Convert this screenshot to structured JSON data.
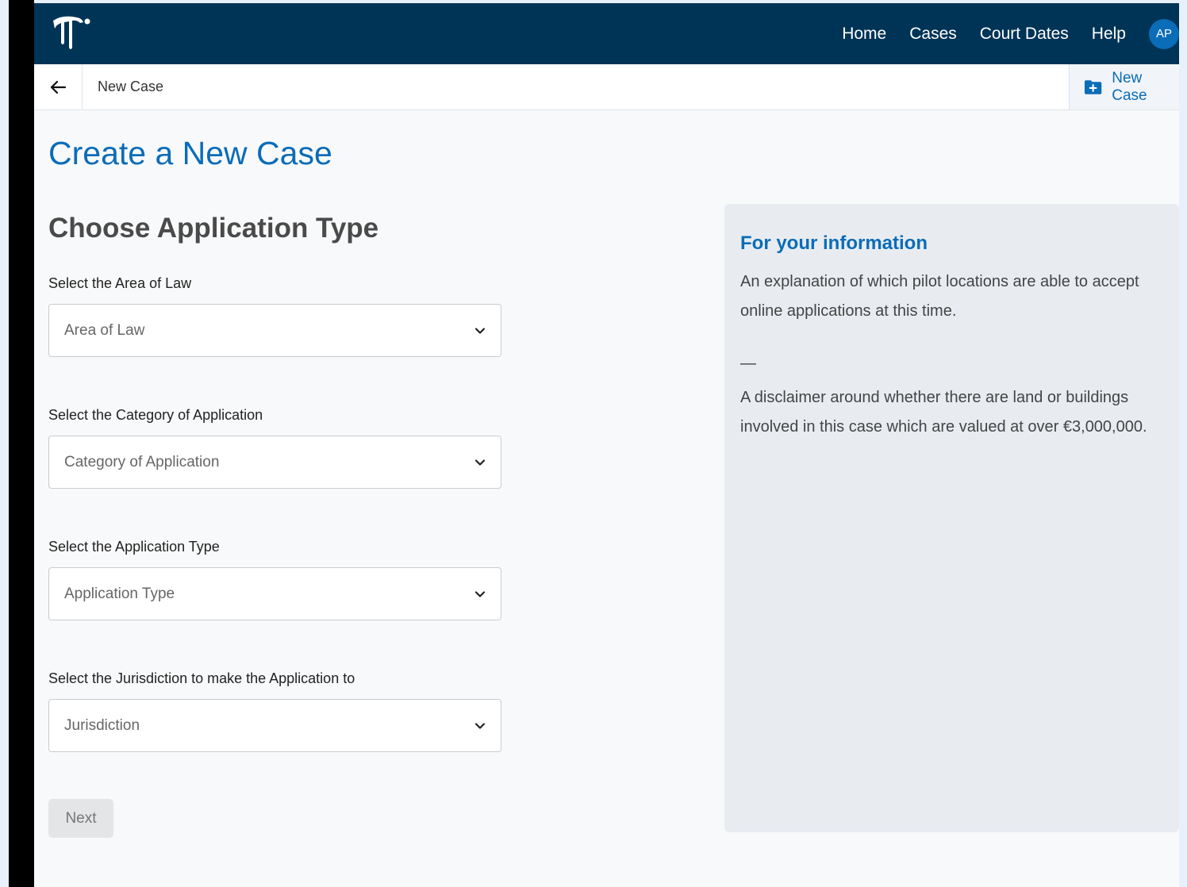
{
  "nav": {
    "links": [
      "Home",
      "Cases",
      "Court Dates",
      "Help"
    ],
    "avatar_initials": "AP"
  },
  "subbar": {
    "title": "New Case",
    "action_label": "New Case"
  },
  "page": {
    "title": "Create a New Case",
    "section_title": "Choose Application Type"
  },
  "form": {
    "fields": [
      {
        "label": "Select the Area of Law",
        "placeholder": "Area of Law"
      },
      {
        "label": "Select the Category of Application",
        "placeholder": "Category of Application"
      },
      {
        "label": "Select the Application Type",
        "placeholder": "Application Type"
      },
      {
        "label": "Select the Jurisdiction to make the Application to",
        "placeholder": "Jurisdiction"
      }
    ],
    "next_label": "Next"
  },
  "info": {
    "title": "For your information",
    "paragraph1": "An explanation of which pilot locations are able to accept online applications at this time.",
    "separator": "—",
    "paragraph2": "A disclaimer around whether there are land or buildings involved in this case which are valued at over €3,000,000."
  },
  "colors": {
    "topbar": "#003457",
    "accent": "#0b6cb8"
  }
}
